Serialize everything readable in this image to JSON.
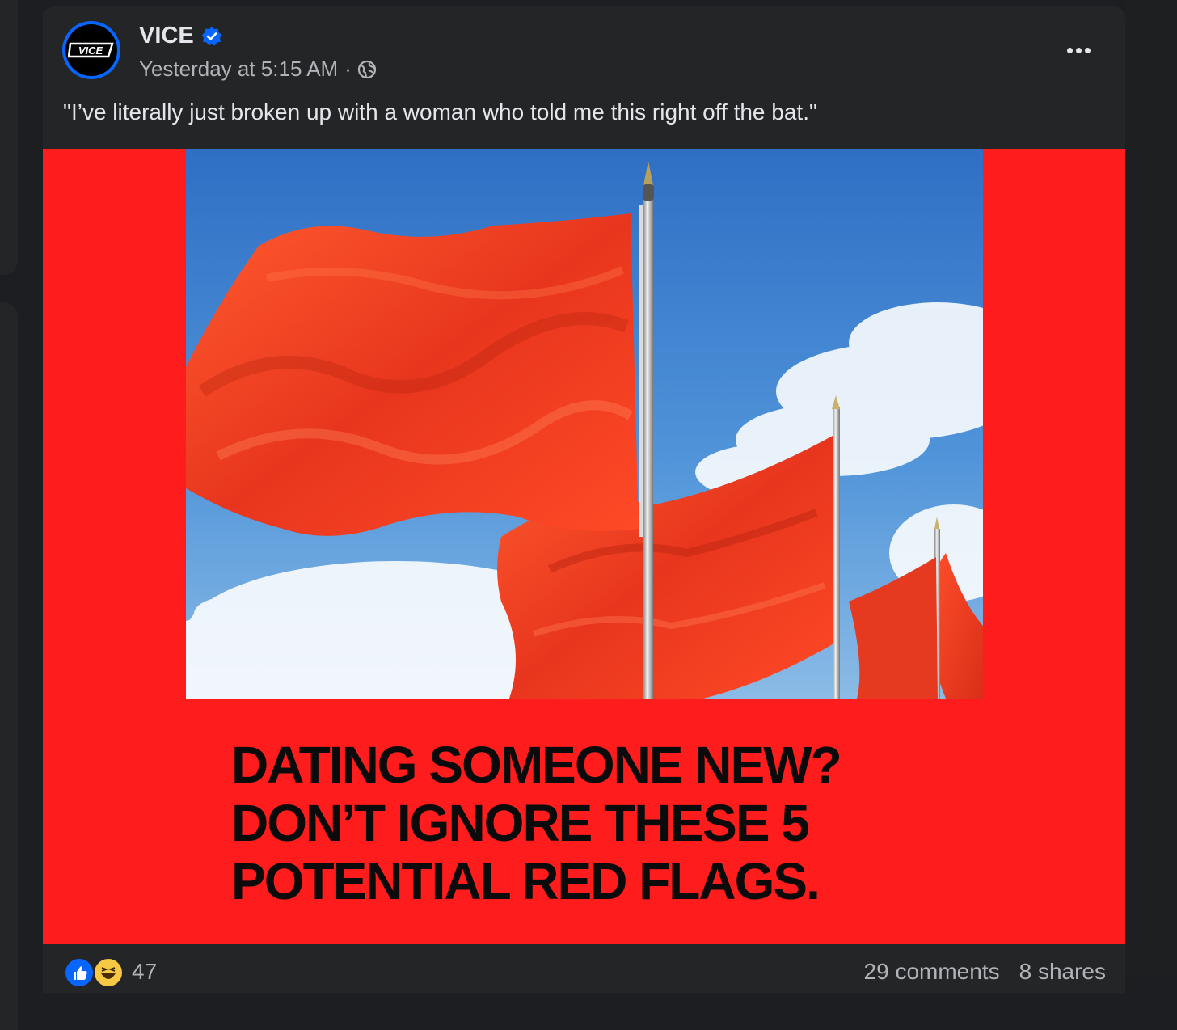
{
  "post": {
    "page_name": "VICE",
    "avatar_logo": "VICE",
    "verified_icon": "verified-badge-icon",
    "timestamp": "Yesterday at 5:15 AM",
    "separator": "·",
    "audience_icon": "globe-icon",
    "more_icon": "more-options-icon",
    "caption": "\"I’ve literally just broken up with a woman who told me this right off the bat.\""
  },
  "media": {
    "headline_lines": [
      "DATING SOMEONE NEW?",
      "DON’T IGNORE THESE 5",
      "POTENTIAL RED FLAGS."
    ],
    "background_color": "#ff1c1c",
    "photo_subject": "red flags waving against blue sky"
  },
  "footer": {
    "reaction_icons": [
      "like-icon",
      "haha-icon"
    ],
    "reaction_count": "47",
    "comments": "29 comments",
    "shares": "8 shares"
  },
  "colors": {
    "card": "#242526",
    "text_primary": "#e4e6eb",
    "text_secondary": "#b0b3b8",
    "accent_blue": "#0866ff"
  }
}
